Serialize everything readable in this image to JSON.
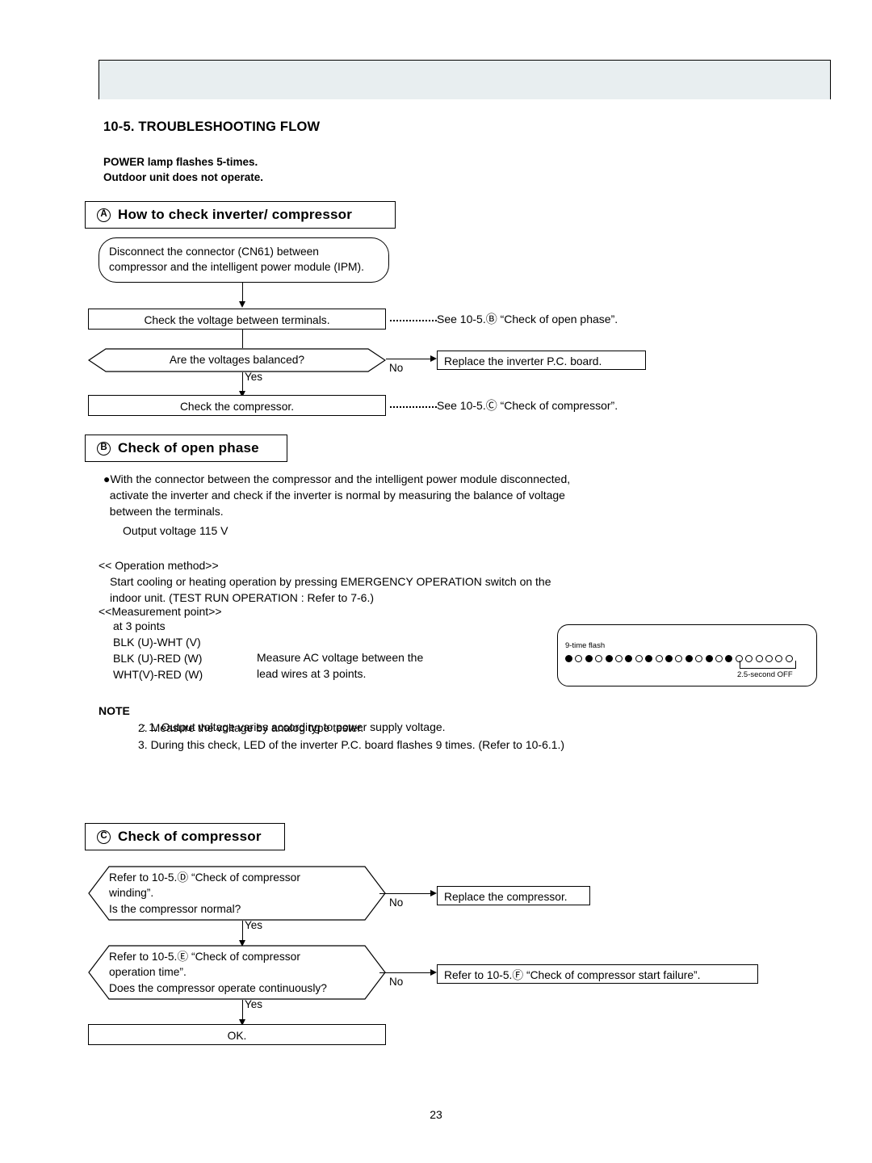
{
  "document": {
    "page_number": "23",
    "section_title": "10-5. TROUBLESHOOTING FLOW",
    "intro_line1": "POWER lamp flashes 5-times.",
    "intro_line2": "Outdoor unit does not operate."
  },
  "section_a": {
    "marker": "A",
    "heading": "How to check inverter/ compressor",
    "step1": "Disconnect the connector (CN61) between compressor and the intelligent power module (IPM).",
    "step2": "Check the voltage between terminals.",
    "step2_ref": "See 10-5.Ⓑ “Check of open phase”.",
    "decision": "Are the voltages balanced?",
    "decision_no": "No",
    "decision_yes": "Yes",
    "no_branch": "Replace the inverter P.C. board.",
    "step3": "Check the compressor.",
    "step3_ref": "See 10-5.Ⓒ “Check of compressor”."
  },
  "section_b": {
    "marker": "B",
    "heading": "Check of open phase",
    "bullet": "●With the connector between the compressor and the intelligent power module disconnected,\n  activate the inverter and check if the inverter is normal by measuring the balance of voltage\n  between the terminals.",
    "output_voltage": "Output voltage 115 V",
    "operation_method_title": "<< Operation method>>",
    "operation_method_body": "Start cooling or heating operation by pressing EMERGENCY OPERATION switch on the\nindoor unit. (TEST RUN OPERATION : Refer to 7-6.)",
    "measurement_point_title": "<<Measurement point>>",
    "measurement_points": "at 3 points\nBLK (U)-WHT (V)\nBLK (U)-RED (W)\nWHT(V)-RED (W)",
    "measure_caption": "Measure AC voltage between the\nlead wires at 3 points.",
    "flash_label": "9-time flash",
    "flash_off_label": "2.5-second OFF",
    "note_label": "NOTE",
    "note_1": "1. Output voltage varies according to power supply voltage.",
    "note_2": "2. Measure the voltage by analog type tester.",
    "note_3": "3. During this check, LED of the inverter P.C. board flashes 9 times. (Refer to 10-6.1.)"
  },
  "section_c": {
    "marker": "C",
    "heading": "Check of compressor",
    "decision1": "Refer to 10-5.Ⓓ “Check of compressor\nwinding”.\nIs the compressor normal?",
    "decision1_no": "No",
    "decision1_yes": "Yes",
    "no_branch1": "Replace the compressor.",
    "decision2": "Refer to 10-5.Ⓔ “Check of compressor\noperation time”.\nDoes the compressor operate continuously?",
    "decision2_no": "No",
    "decision2_yes": "Yes",
    "no_branch2": "Refer to 10-5.Ⓕ “Check of compressor start failure”.",
    "final": "OK."
  },
  "flash_pattern": {
    "sequence": [
      "on",
      "off",
      "on",
      "off",
      "on",
      "off",
      "on",
      "off",
      "on",
      "off",
      "on",
      "off",
      "on",
      "off",
      "on",
      "off",
      "on",
      "off",
      "off",
      "off",
      "off",
      "off",
      "off"
    ]
  }
}
